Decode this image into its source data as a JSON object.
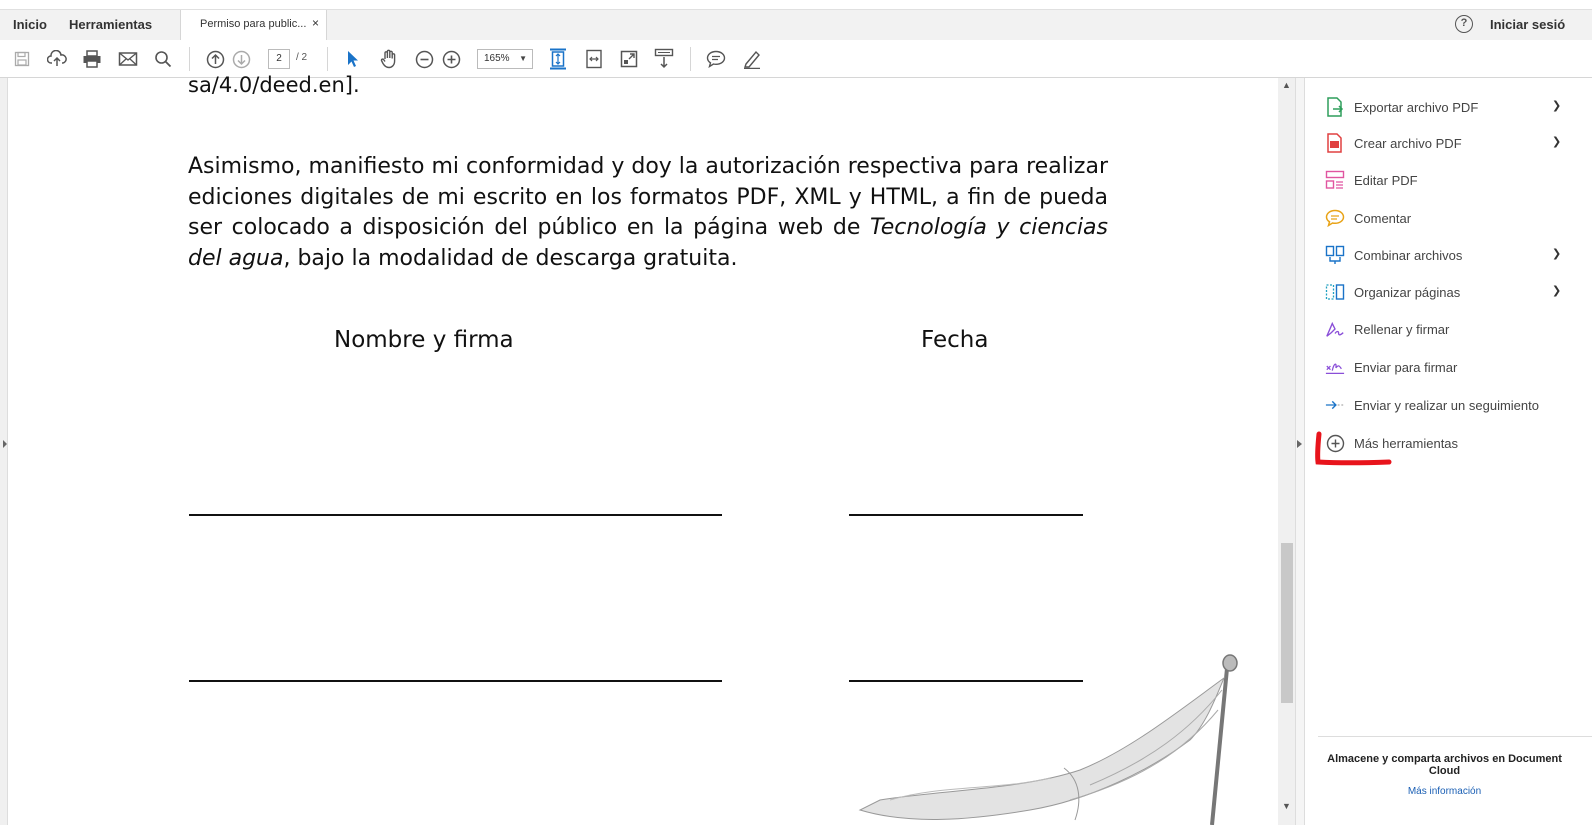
{
  "tabs": {
    "home": "Inicio",
    "tools": "Herramientas",
    "document": "Permiso para public...",
    "close": "×"
  },
  "account": {
    "help": "?",
    "signin": "Iniciar sesió"
  },
  "toolbar": {
    "current_page": "2",
    "total_pages": "/ 2",
    "zoom": "165%",
    "icons": [
      "save-icon",
      "upload-icon",
      "print-icon",
      "email-icon",
      "search-icon",
      "page-up-icon",
      "page-down-icon",
      "select-icon",
      "hand-icon",
      "zoom-out-icon",
      "zoom-in-icon",
      "fit-page-icon",
      "fit-width-icon",
      "full-screen-icon",
      "read-mode-icon",
      "comment-icon",
      "highlight-icon"
    ]
  },
  "document": {
    "url_fragment": "sa/4.0/deed.en].",
    "paragraph_start": "Asimismo, manifiesto mi conformidad y doy la autorización respectiva para realizar ediciones digitales de mi escrito en los formatos PDF, XML y HTML, a fin de pueda ser colocado a disposición del público en la página web de ",
    "paragraph_italic": "Tecnología y ciencias del agua",
    "paragraph_end": ", bajo la modalidad de descarga gratuita.",
    "heading_name": "Nombre y firma",
    "heading_date": "Fecha"
  },
  "right_panel": {
    "tools": [
      {
        "label": "Exportar archivo PDF",
        "icon": "export-pdf-icon",
        "chevron": true
      },
      {
        "label": "Crear archivo PDF",
        "icon": "create-pdf-icon",
        "chevron": true
      },
      {
        "label": "Editar PDF",
        "icon": "edit-pdf-icon",
        "chevron": false
      },
      {
        "label": "Comentar",
        "icon": "comment-icon",
        "chevron": false
      },
      {
        "label": "Combinar archivos",
        "icon": "combine-files-icon",
        "chevron": true
      },
      {
        "label": "Organizar páginas",
        "icon": "organize-pages-icon",
        "chevron": true
      },
      {
        "label": "Rellenar y firmar",
        "icon": "fill-sign-icon",
        "chevron": false
      },
      {
        "label": "Enviar para firmar",
        "icon": "send-sign-icon",
        "chevron": false
      },
      {
        "label": "Enviar y realizar un seguimiento",
        "icon": "send-track-icon",
        "chevron": false
      },
      {
        "label": "Más herramientas",
        "icon": "more-tools-icon",
        "chevron": false
      }
    ],
    "footer_text": "Almacene y comparta archivos en Document Cloud",
    "footer_link": "Más información"
  },
  "colors": {
    "accent_blue": "#1a73c8",
    "annotation_red": "#e8141c"
  }
}
